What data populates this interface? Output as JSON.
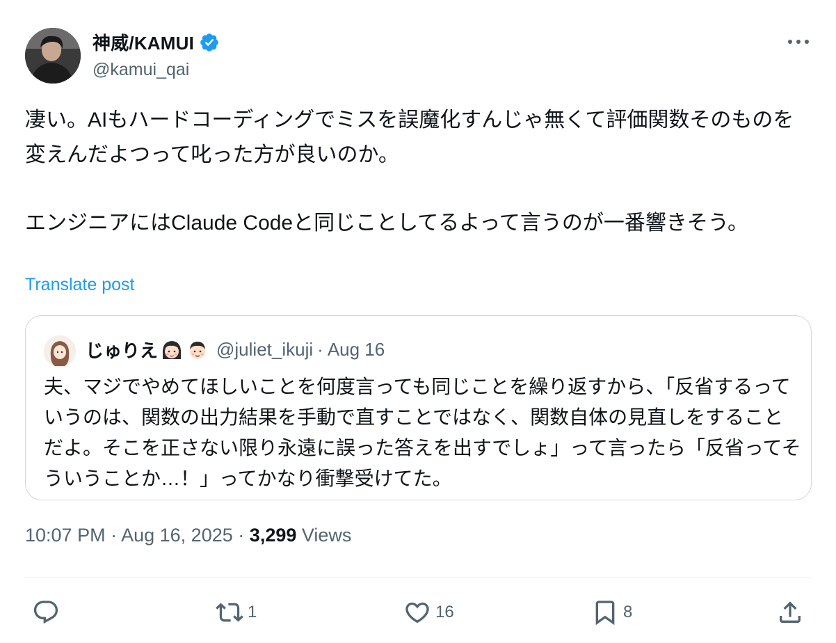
{
  "author": {
    "display_name": "神威/KAMUI",
    "handle": "@kamui_qai",
    "verified": true,
    "avatar_icon": "user-photo-avatar"
  },
  "post": {
    "paragraph1": "凄い。AIもハードコーディングでミスを誤魔化すんじゃ無くて評価関数そのものを変えんだよつって叱った方が良いのか。",
    "paragraph2": "エンジニアにはClaude Codeと同じことしてるよって言うのが一番響きそう。",
    "translate_label": "Translate post"
  },
  "quote": {
    "display_name": "じゅりえ",
    "emojis": [
      "girl-face-emoji",
      "boy-face-emoji"
    ],
    "handle": "@juliet_ikuji",
    "separator": "·",
    "date": "Aug 16",
    "text": "夫、マジでやめてほしいことを何度言っても同じことを繰り返すから、「反省するっていうのは、関数の出力結果を手動で直すことではなく、関数自体の見直しをすることだよ。そこを正さない限り永遠に誤った答えを出すでしょ」って言ったら「反省ってそういうことか…！」ってかなり衝撃受けてた。"
  },
  "meta": {
    "time": "10:07 PM",
    "separator": "·",
    "date": "Aug 16, 2025",
    "separator2": "·",
    "views_count": "3,299",
    "views_label": "Views"
  },
  "actions": {
    "reply_count": "",
    "repost_count": "1",
    "like_count": "16",
    "bookmark_count": "8"
  },
  "colors": {
    "accent": "#1d9bf0",
    "secondary_text": "#536471",
    "primary_text": "#0f1419",
    "border": "#cfd9de"
  }
}
